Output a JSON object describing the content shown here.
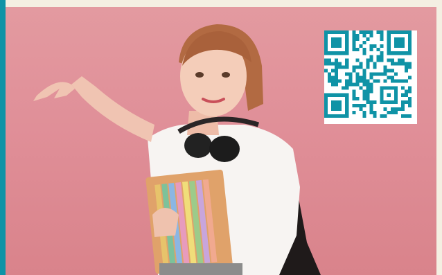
{
  "image": {
    "subject": "photo",
    "has_qr_code": true
  },
  "palette": {
    "background": "#f4efe2",
    "accent": "#0f93a6",
    "photo_bg": "#e08f98",
    "qr_color": "#0f93a6"
  },
  "icons": [
    "qr-code-icon"
  ]
}
